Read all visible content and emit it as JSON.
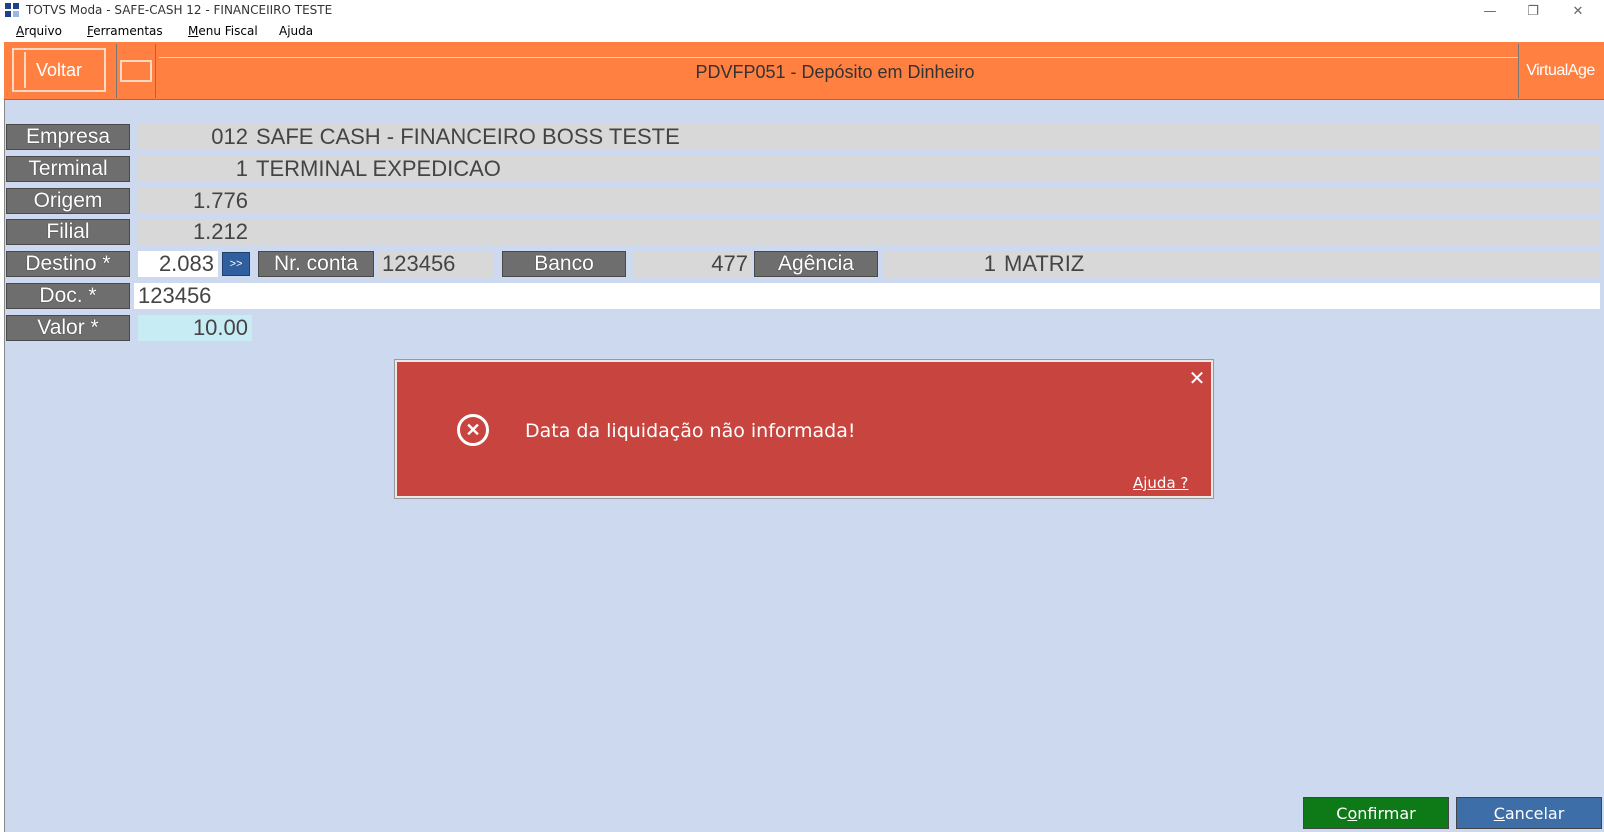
{
  "window": {
    "title": "TOTVS Moda - SAFE-CASH 12 - FINANCEIIRO TESTE",
    "minimize": "—",
    "restore": "❐",
    "close": "✕"
  },
  "menu": {
    "items": [
      {
        "first": "A",
        "rest": "rquivo"
      },
      {
        "first": "F",
        "rest": "erramentas"
      },
      {
        "first": "M",
        "rest": "enu Fiscal"
      },
      {
        "first": "",
        "rest": "Ajuda"
      }
    ]
  },
  "header": {
    "back_label": "Voltar",
    "title": "PDVFP051 - Depósito em Dinheiro",
    "brand": "VirtualAge"
  },
  "form": {
    "empresa": {
      "label": "Empresa",
      "code": "012",
      "name": "SAFE CASH - FINANCEIRO BOSS TESTE"
    },
    "terminal": {
      "label": "Terminal",
      "code": "1",
      "name": "TERMINAL EXPEDICAO"
    },
    "origem": {
      "label": "Origem",
      "value": "1.776"
    },
    "filial": {
      "label": "Filial",
      "value": "1.212"
    },
    "destino": {
      "label": "Destino *",
      "value": "2.083",
      "lookup": ">>"
    },
    "nr_conta": {
      "label": "Nr. conta",
      "value": "123456"
    },
    "banco": {
      "label": "Banco",
      "value": "477"
    },
    "agencia": {
      "label": "Agência",
      "code": "1",
      "name": "MATRIZ"
    },
    "doc": {
      "label": "Doc. *",
      "value": "123456"
    },
    "valor": {
      "label": "Valor *",
      "value": "10.00"
    }
  },
  "dialog": {
    "message": "Data da liquidação não informada!",
    "help": "Ajuda ?",
    "close": "✕",
    "icon": "✕"
  },
  "footer": {
    "confirm_u": "o",
    "confirm_pre": "C",
    "confirm_post": "nfirmar",
    "cancel_u": "C",
    "cancel_post": "ancelar"
  },
  "colors": {
    "header": "#ff8040",
    "background": "#cdd9ee",
    "error": "#c8443f",
    "confirm": "#0e7a17",
    "cancel": "#3d6ea8"
  }
}
